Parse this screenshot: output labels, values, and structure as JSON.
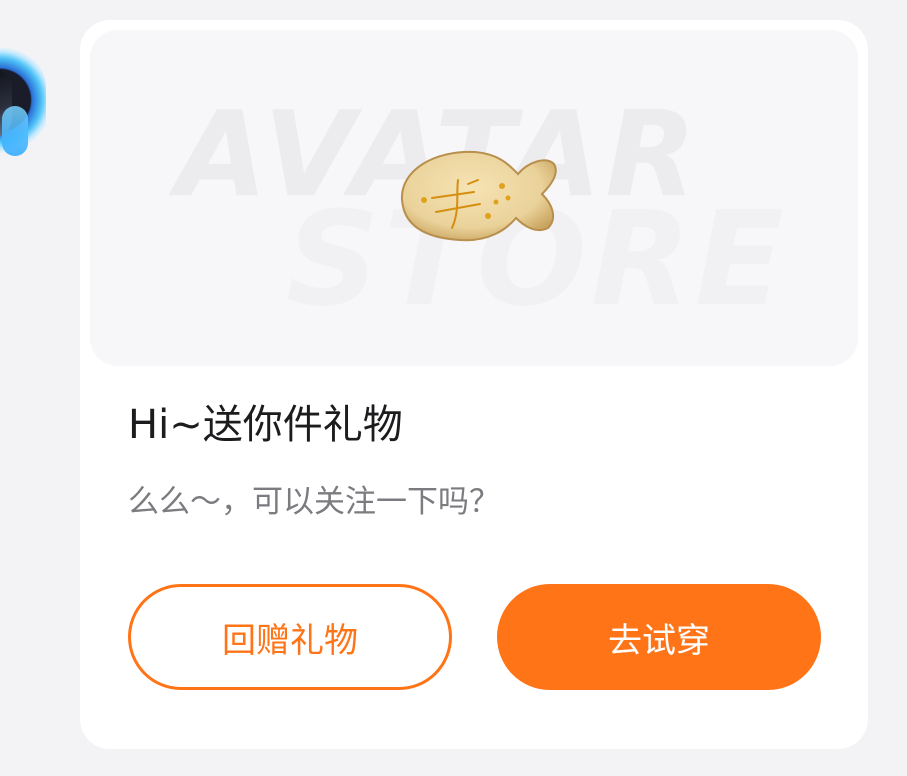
{
  "card": {
    "banner_watermark_line1": "AVATAR",
    "banner_watermark_line2": "STORE",
    "title": "Hi~送你件礼物",
    "message": "么么～，可以关注一下吗？",
    "buttons": {
      "return_gift": "回赠礼物",
      "try_on": "去试穿"
    }
  },
  "colors": {
    "accent": "#ff7417",
    "card_bg": "#ffffff",
    "page_bg": "#f3f3f5",
    "banner_bg": "#f7f7f9"
  },
  "icons": {
    "gift_item": "fish-cookie-icon",
    "sender_avatar": "avatar"
  }
}
